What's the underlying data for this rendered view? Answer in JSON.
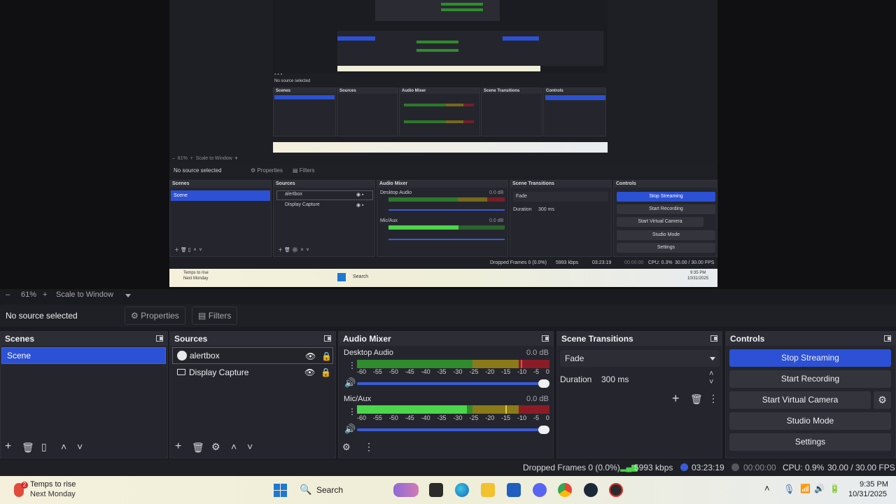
{
  "zoom": {
    "minus": "–",
    "value": "61%",
    "plus": "+",
    "scale_label": "Scale to Window"
  },
  "source_bar": {
    "no_source": "No source selected",
    "properties_label": "Properties",
    "filters_label": "Filters"
  },
  "scenes": {
    "title": "Scenes",
    "items": [
      "Scene"
    ]
  },
  "sources": {
    "title": "Sources",
    "items": [
      {
        "name": "alertbox"
      },
      {
        "name": "Display Capture"
      }
    ]
  },
  "audio_mixer": {
    "title": "Audio Mixer",
    "channels": [
      {
        "name": "Desktop Audio",
        "db": "0.0 dB",
        "level": 0.85
      },
      {
        "name": "Mic/Aux",
        "db": "0.0 dB",
        "level": 0.57
      }
    ],
    "ticks": [
      "-60",
      "-55",
      "-50",
      "-45",
      "-40",
      "-35",
      "-30",
      "-25",
      "-20",
      "-15",
      "-10",
      "-5",
      "0"
    ]
  },
  "scene_transitions": {
    "title": "Scene Transitions",
    "transition": "Fade",
    "duration_label": "Duration",
    "duration_value": "300 ms"
  },
  "controls": {
    "title": "Controls",
    "stop_streaming": "Stop Streaming",
    "start_recording": "Start Recording",
    "start_virtual_camera": "Start Virtual Camera",
    "studio_mode": "Studio Mode",
    "settings": "Settings"
  },
  "status": {
    "dropped_frames": "Dropped Frames 0 (0.0%)",
    "bitrate": "5993 kbps",
    "stream_time": "03:23:19",
    "record_time": "00:00:00",
    "cpu": "CPU: 0.9%",
    "fps": "30.00 / 30.00 FPS"
  },
  "preview_nested": {
    "zoom_value": "61%",
    "scale_label": "Scale to Window",
    "no_source": "No source selected",
    "properties_label": "Properties",
    "filters_label": "Filters",
    "scenes_title": "Scenes",
    "scene_item": "Scene",
    "sources_title": "Sources",
    "source1": "alertbox",
    "source2": "Display Capture",
    "mixer_title": "Audio Mixer",
    "desktop_audio": "Desktop Audio",
    "mic_aux": "Mic/Aux",
    "db": "0.0 dB",
    "transitions_title": "Scene Transitions",
    "fade": "Fade",
    "duration": "Duration",
    "duration_value": "300 ms",
    "controls_title": "Controls",
    "stop_streaming": "Stop Streaming",
    "start_recording": "Start Recording",
    "start_virtual_camera": "Start Virtual Camera",
    "studio_mode": "Studio Mode",
    "settings": "Settings",
    "dropped": "Dropped Frames 0 (0.0%)",
    "kbps": "5993 kbps",
    "time": "03:23:19",
    "rec_time": "00:00:00",
    "cpu": "CPU: 0.3%",
    "fps": "30.00 / 30.00 FPS",
    "weather_line1": "Temps to rise",
    "weather_line2": "Next Monday",
    "search": "Search",
    "clock_time": "9:35 PM",
    "clock_date": "10/31/2025"
  },
  "taskbar": {
    "weather_line1": "Temps to rise",
    "weather_line2": "Next Monday",
    "search_label": "Search",
    "time": "9:35 PM",
    "date": "10/31/2025"
  }
}
